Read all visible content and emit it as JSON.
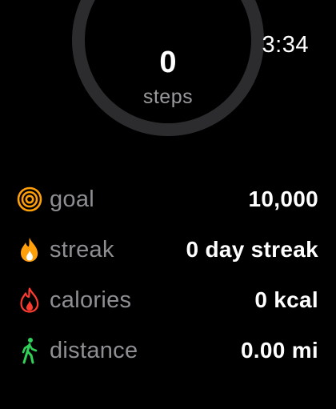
{
  "clock": {
    "time": "3:34"
  },
  "activity_ring": {
    "count": "0",
    "unit_label": "steps"
  },
  "stats": [
    {
      "icon": "target-icon",
      "label": "goal",
      "value": "10,000",
      "color": "#ff9f0a"
    },
    {
      "icon": "flame-icon",
      "label": "streak",
      "value": "0 day streak",
      "color": "#ff9f0a"
    },
    {
      "icon": "calorie-flame-icon",
      "label": "calories",
      "value": "0 kcal",
      "color": "#ff3b30"
    },
    {
      "icon": "walking-figure-icon",
      "label": "distance",
      "value": "0.00 mi",
      "color": "#30d158"
    }
  ],
  "colors": {
    "background": "#000000",
    "ring_track": "#2c2c2e",
    "label_gray": "#8e8e93"
  }
}
